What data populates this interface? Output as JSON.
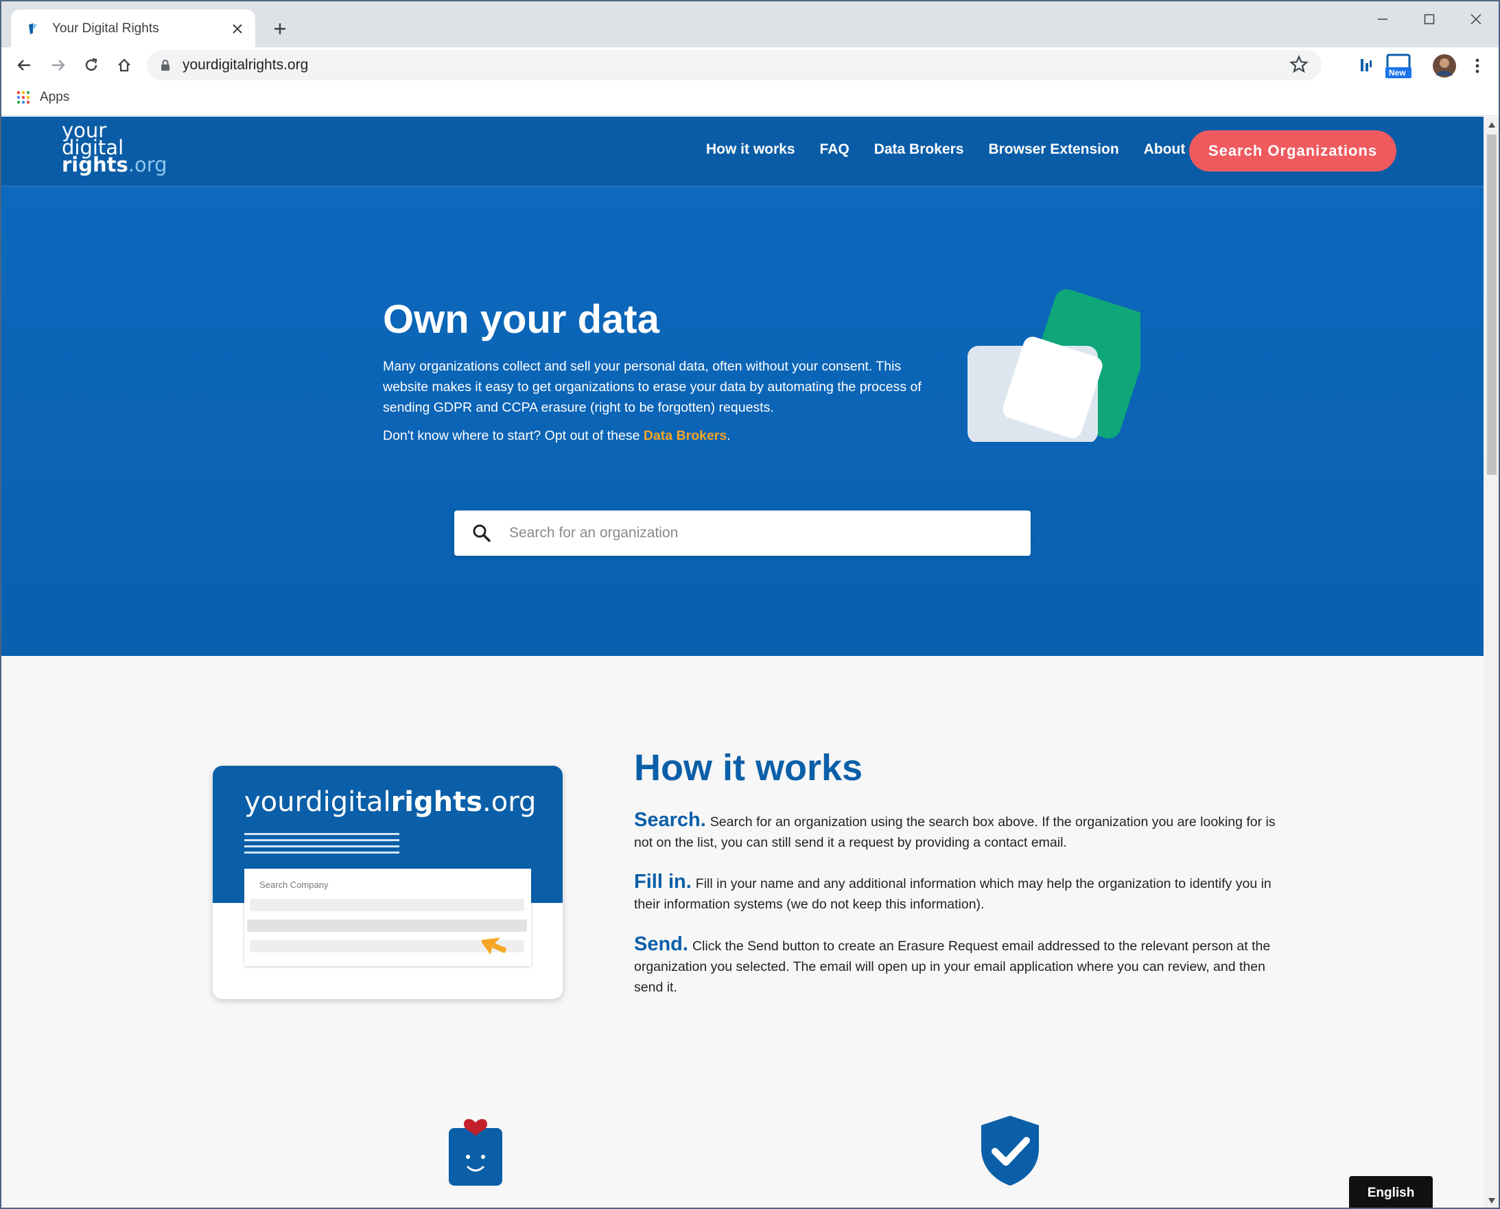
{
  "browser": {
    "tab_title": "Your Digital Rights",
    "url": "yourdigitalrights.org",
    "bookmarks_apps_label": "Apps",
    "extension_badge": "New"
  },
  "header": {
    "logo_line1": "your",
    "logo_line2": "digital",
    "logo_line3": "rights",
    "logo_suffix": ".org",
    "nav": [
      {
        "label": "How it works"
      },
      {
        "label": "FAQ"
      },
      {
        "label": "Data Brokers"
      },
      {
        "label": "Browser Extension"
      },
      {
        "label": "About"
      }
    ],
    "cta_label": "Search Organizations"
  },
  "hero": {
    "title": "Own your data",
    "paragraph": "Many organizations collect and sell your personal data, often without your consent. This website makes it easy to get organizations to erase your data by automating the process of sending GDPR and CCPA erasure (right to be forgotten) requests.",
    "prompt_prefix": "Don't know where to start? Opt out of these ",
    "prompt_link": "Data Brokers",
    "prompt_suffix": ".",
    "search_placeholder": "Search for an organization"
  },
  "how_it_works": {
    "title": "How it works",
    "card_brand_plain": "yourdigital",
    "card_brand_bold": "rights",
    "card_brand_suffix": ".org",
    "card_search_label": "Search Company",
    "steps": [
      {
        "head": "Search.",
        "text": "Search for an organization using the search box above. If the organization you are looking for is not on the list, you can still send it a request by providing a contact email."
      },
      {
        "head": "Fill in.",
        "text": "Fill in your name and any additional information which may help the organization to identify you in their information systems (we do not keep this information)."
      },
      {
        "head": "Send.",
        "text": "Click the Send button to create an Erasure Request email addressed to the relevant person at the organization you selected. The email will open up in your email application where you can review, and then send it."
      }
    ]
  },
  "language": "English",
  "colors": {
    "brand_blue": "#0b5fa8",
    "cta_red": "#ef5a5f",
    "link_orange": "#f5a623",
    "accent_green": "#0fa67a"
  }
}
